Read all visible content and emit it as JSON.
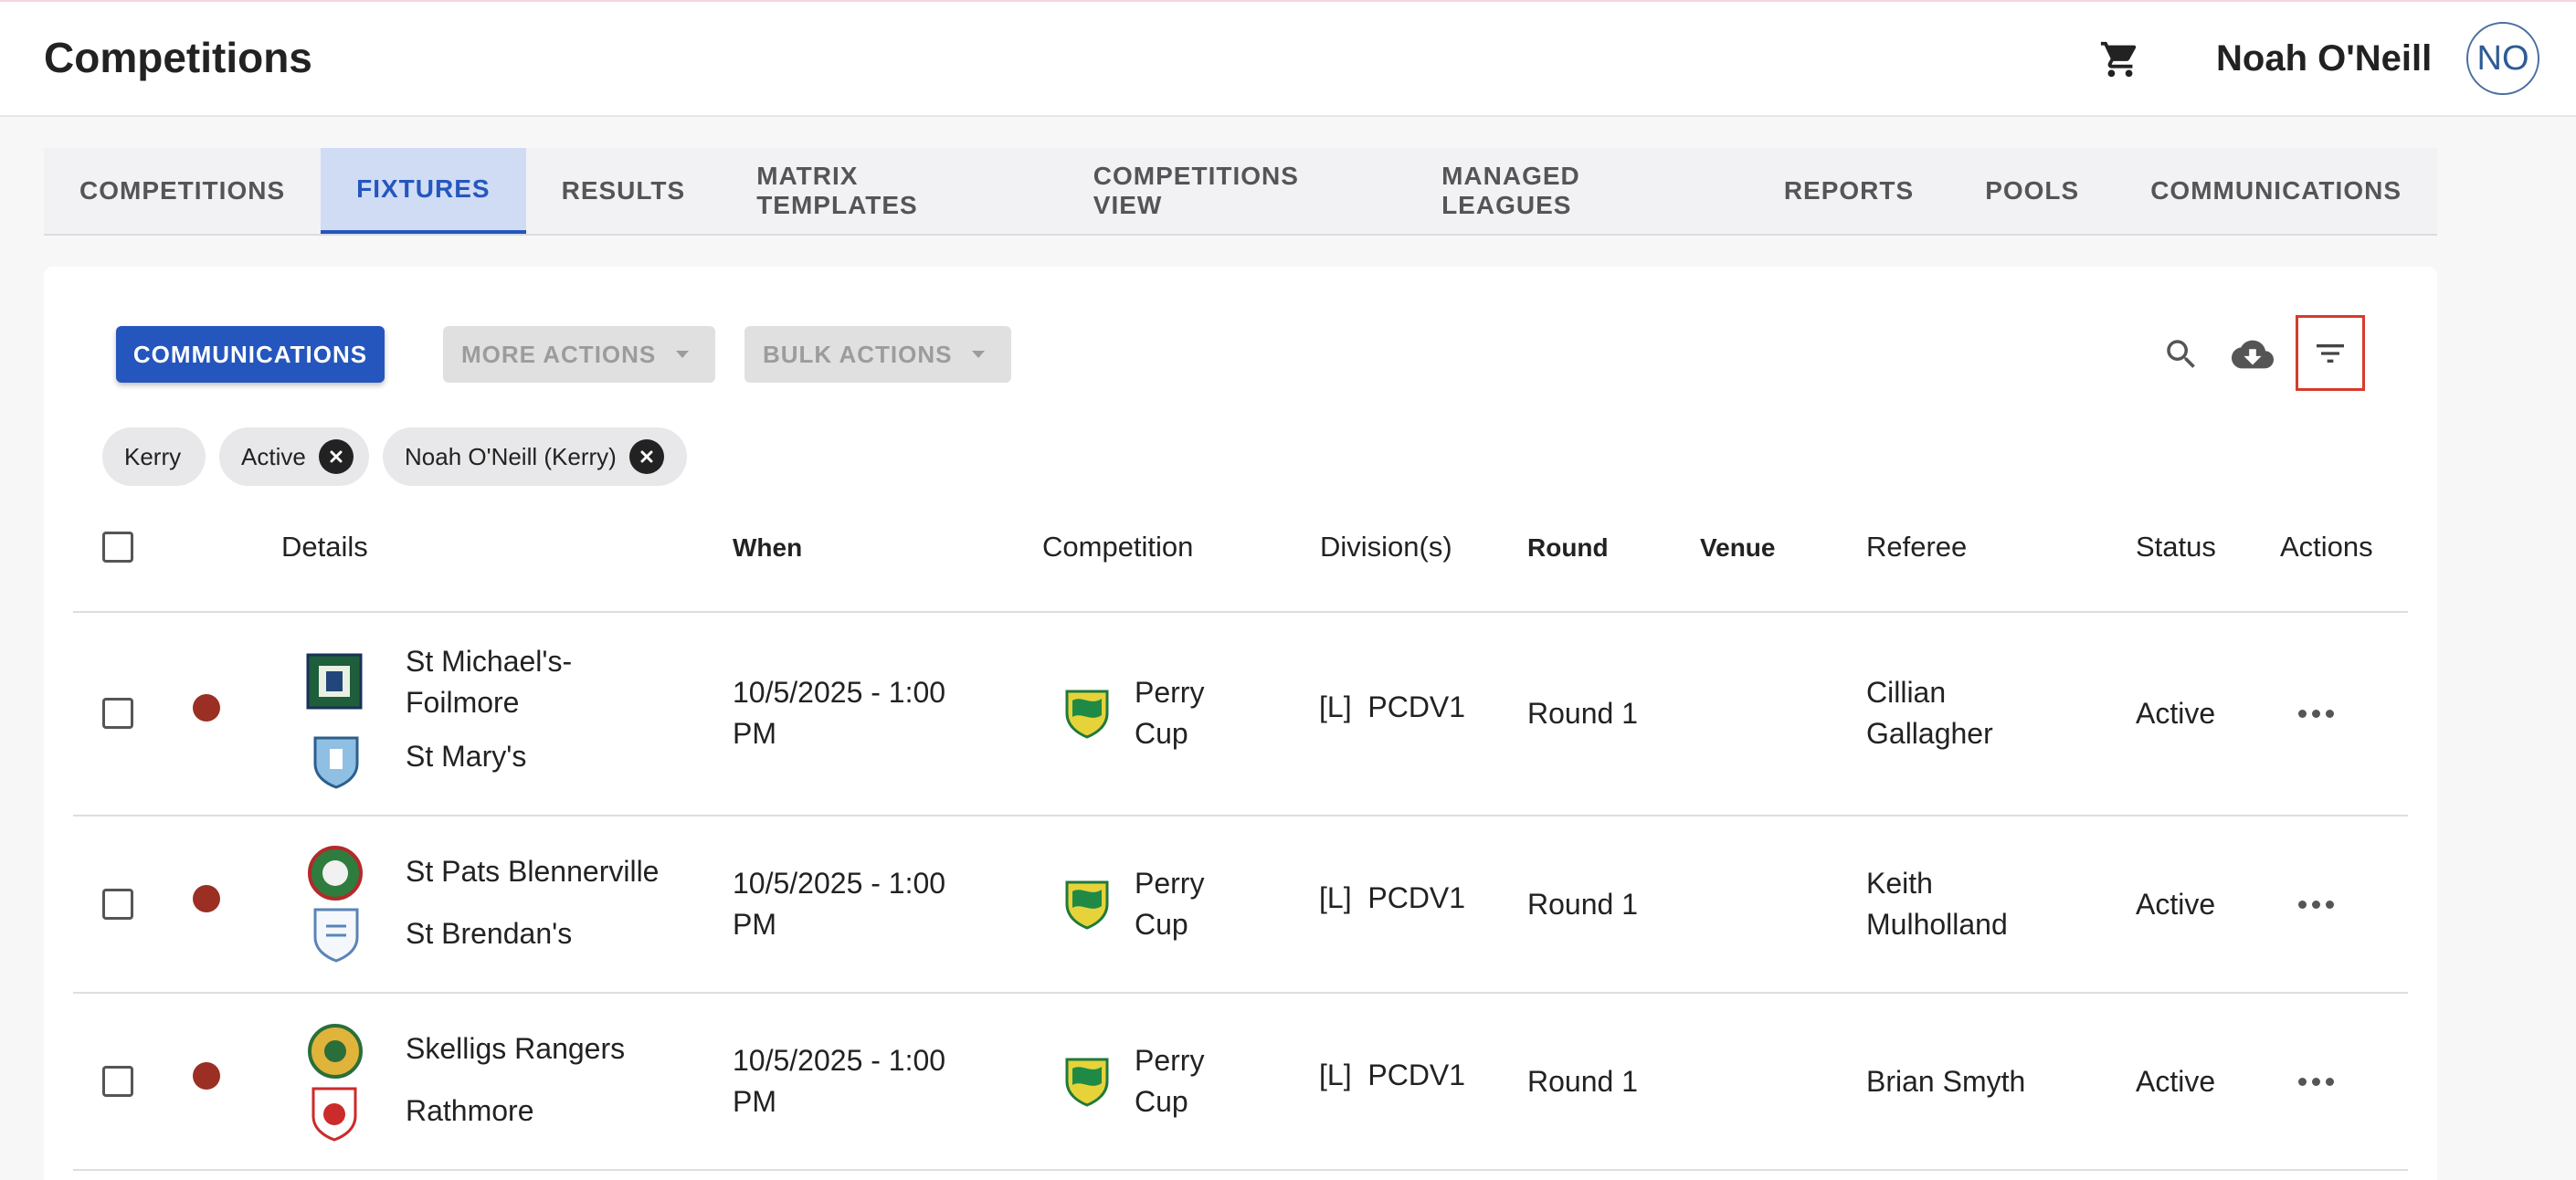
{
  "header": {
    "title": "Competitions",
    "cart_icon": "cart-icon",
    "user_name": "Noah O'Neill",
    "avatar_initials": "NO"
  },
  "tabs": [
    {
      "label": "COMPETITIONS"
    },
    {
      "label": "FIXTURES",
      "active": true
    },
    {
      "label": "RESULTS"
    },
    {
      "label": "MATRIX TEMPLATES"
    },
    {
      "label": "COMPETITIONS VIEW"
    },
    {
      "label": "MANAGED LEAGUES"
    },
    {
      "label": "REPORTS"
    },
    {
      "label": "POOLS"
    },
    {
      "label": "COMMUNICATIONS"
    }
  ],
  "toolbar": {
    "communications_label": "COMMUNICATIONS",
    "more_actions_label": "MORE ACTIONS",
    "bulk_actions_label": "BULK ACTIONS"
  },
  "filters": [
    {
      "label": "Kerry",
      "removable": false
    },
    {
      "label": "Active",
      "removable": true
    },
    {
      "label": "Noah O'Neill (Kerry)",
      "removable": true
    }
  ],
  "table": {
    "columns": [
      "Details",
      "When",
      "Competition",
      "Division(s)",
      "Round",
      "Venue",
      "Referee",
      "Status",
      "Actions"
    ],
    "rows": [
      {
        "team1": "St Michael's-\nFoilmore",
        "team2": "St Mary's",
        "when": "10/5/2025 - 1:00\nPM",
        "competition": "Perry\nCup",
        "division": "[L]  PCDV1",
        "round": "Round 1",
        "venue": "",
        "referee": "Cillian\nGallagher",
        "status": "Active"
      },
      {
        "team1": "St Pats Blennerville",
        "team2": "St Brendan's",
        "when": "10/5/2025 - 1:00\nPM",
        "competition": "Perry\nCup",
        "division": "[L]  PCDV1",
        "round": "Round 1",
        "venue": "",
        "referee": "Keith\nMulholland",
        "status": "Active"
      },
      {
        "team1": "Skelligs Rangers",
        "team2": "Rathmore",
        "when": "10/5/2025 - 1:00\nPM",
        "competition": "Perry\nCup",
        "division": "[L]  PCDV1",
        "round": "Round 1",
        "venue": "",
        "referee": "Brian Smyth",
        "status": "Active"
      }
    ]
  },
  "colors": {
    "accent": "#2556be",
    "status_dot": "#9b2f23",
    "highlight": "#d83b2b"
  }
}
